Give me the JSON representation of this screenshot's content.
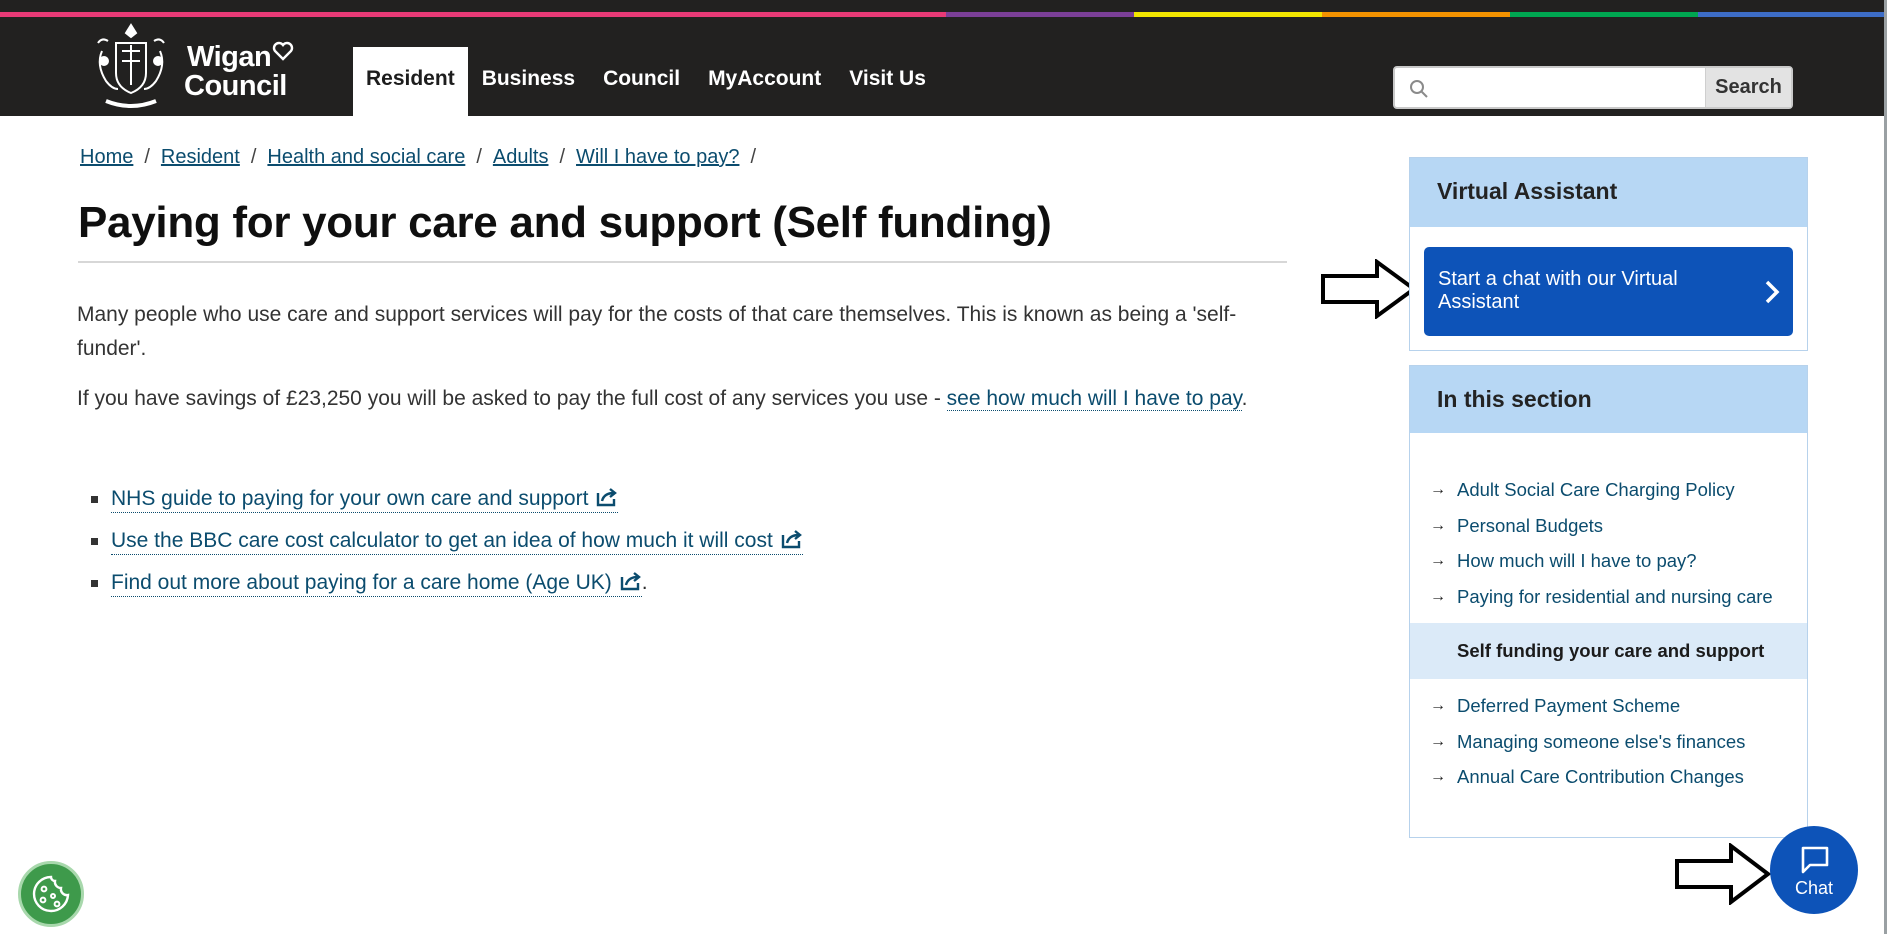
{
  "header": {
    "logo": {
      "line1": "Wigan",
      "line2": "Council"
    },
    "nav": [
      {
        "label": "Resident",
        "active": true
      },
      {
        "label": "Business",
        "active": false
      },
      {
        "label": "Council",
        "active": false
      },
      {
        "label": "MyAccount",
        "active": false
      },
      {
        "label": "Visit Us",
        "active": false
      }
    ],
    "search": {
      "placeholder": "",
      "button_label": "Search"
    }
  },
  "colors": {
    "header_bg": "#222120",
    "link": "#0b4c6e",
    "accent_blue": "#0d53b8",
    "panel_head": "#b7d7f4",
    "rainbow": [
      "#e83a76",
      "#7b3f97",
      "#f2e600",
      "#f39200",
      "#00a651",
      "#3d6dc7"
    ]
  },
  "breadcrumb": [
    {
      "label": "Home"
    },
    {
      "label": "Resident"
    },
    {
      "label": "Health and social care"
    },
    {
      "label": "Adults"
    },
    {
      "label": "Will I have to pay?"
    }
  ],
  "breadcrumb_separator": "/",
  "page": {
    "title": "Paying for your care and support (Self funding)",
    "para1": "Many people who use care and support services will pay for the costs of that care themselves. This is known as being a 'self-funder'.",
    "para2_text": "If you have savings of £23,250 you will be asked to pay the full cost of any services you use - ",
    "para2_link": "see how much will I have to pay",
    "para2_end": ".",
    "links": [
      {
        "label": "NHS guide to paying for your own care and support",
        "trail": ""
      },
      {
        "label": "Use the BBC care cost calculator to get an idea of how much it will cost",
        "trail": ""
      },
      {
        "label": "Find out more about paying for a care home (Age UK)",
        "trail": "."
      }
    ]
  },
  "sidebar": {
    "virtual_assistant": {
      "heading": "Virtual Assistant",
      "button_label": "Start a chat with our Virtual Assistant"
    },
    "in_this_section": {
      "heading": "In this section",
      "items": [
        {
          "label": "Adult Social Care Charging Policy",
          "current": false
        },
        {
          "label": "Personal Budgets",
          "current": false
        },
        {
          "label": "How much will I have to pay?",
          "current": false
        },
        {
          "label": "Paying for residential and nursing care",
          "current": false
        },
        {
          "label": "Self funding your care and support",
          "current": true
        },
        {
          "label": "Deferred Payment Scheme",
          "current": false
        },
        {
          "label": "Managing someone else's finances",
          "current": false
        },
        {
          "label": "Annual Care Contribution Changes",
          "current": false
        }
      ]
    }
  },
  "chat_widget": {
    "label": "Chat"
  },
  "icons": [
    "crest-icon",
    "heart-icon",
    "search-icon",
    "external-link-icon",
    "chevron-right-icon",
    "chat-bubble-icon",
    "cookie-icon",
    "pointer-arrow-icon"
  ]
}
